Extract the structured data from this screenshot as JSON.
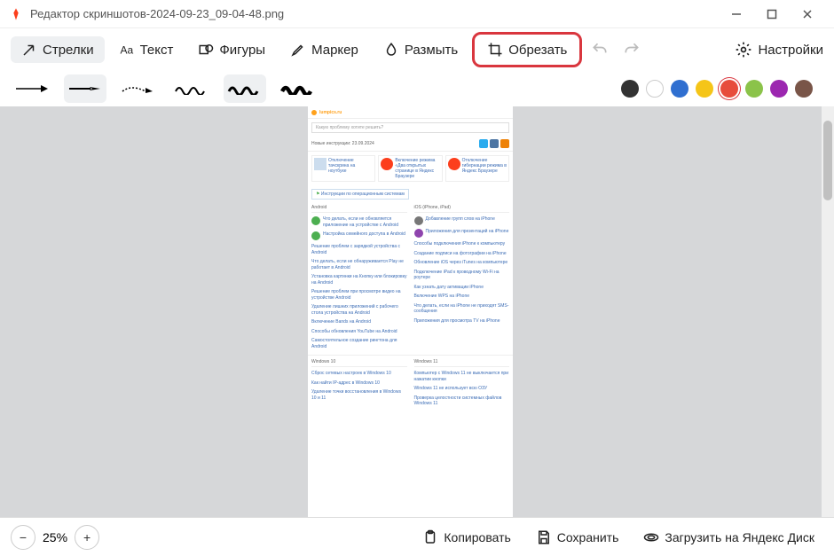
{
  "window": {
    "title_app": "Редактор скриншотов",
    "title_sep": " - ",
    "title_file": "2024-09-23_09-04-48.png"
  },
  "toolbar": {
    "arrows": "Стрелки",
    "text": "Текст",
    "shapes": "Фигуры",
    "marker": "Маркер",
    "blur": "Размыть",
    "crop": "Обрезать",
    "settings": "Настройки"
  },
  "colors": [
    "#333333",
    "#ffffff",
    "#2f6fd0",
    "#f5c518",
    "#e74c3c",
    "#8bc34a",
    "#9c27b0",
    "#795548"
  ],
  "selected_color_index": 4,
  "zoom": "25%",
  "bottom": {
    "copy": "Копировать",
    "save": "Сохранить",
    "upload": "Загрузить на Яндекс Диск"
  },
  "page": {
    "site": "lumpics.ru",
    "search_placeholder": "Какую проблему хотите решить?",
    "new_instr": "Новые инструкции: 23.09.2024",
    "card1": "Отключение тачскрина на ноутбуке",
    "card2": "Включение режима «Два открытых странице в Яндекс Браузере",
    "card3": "Отключение гибернации режима в Яндекс Браузере",
    "os_instr": "Инструкции по операционным системам",
    "col_android": "Android",
    "col_ios": "iOS (iPhone, iPad)",
    "android_items_icon": [
      "Что делать, если не обновляется приложение на устройстве с Android",
      "Настройка семейного доступа в Android"
    ],
    "android_links": [
      "Решение проблем с зарядкой устройства с Android",
      "Что делать, если не обнаруживается Play не работает в Android",
      "Установка картинки на Кнопку или блокировку на Android",
      "Решение проблем при просмотре видео на устройстве Android",
      "Удаление лишних приложений с рабочего стола устройства на Android",
      "Включение Bands на Android",
      "Способы обновления YouTube на Android",
      "Самостоятельное создание рингтона для Android"
    ],
    "ios_items_icon": [
      "Добавление групп слов на iPhone",
      "Приложения для презентаций на iPhone"
    ],
    "ios_links": [
      "Способы подключения iPhone к компьютеру",
      "Создание подписи на фотографии на iPhone",
      "Обновление iOS через iTunes на компьютере",
      "Подключение iPad к проводному Wi-Fi на роутере",
      "Как узнать дату активации iPhone",
      "Включение WPS на iPhone",
      "Что делать, если на iPhone не приходят SMS-сообщения",
      "Приложения для просмотра TV на iPhone"
    ],
    "col_win10": "Windows 10",
    "col_win11": "Windows 11",
    "win10_links": [
      "Сброс сетевых настроек в Windows 10",
      "Как найти IP-адрес в Windows 10",
      "Удаление точки восстановления в Windows 10 и 11"
    ],
    "win11_links": [
      "Компьютер с Windows 11 не выключается при нажатии кнопки",
      "Windows 11 не использует всю ОЗУ",
      "Проверка целостности системных файлов Windows 11"
    ]
  }
}
